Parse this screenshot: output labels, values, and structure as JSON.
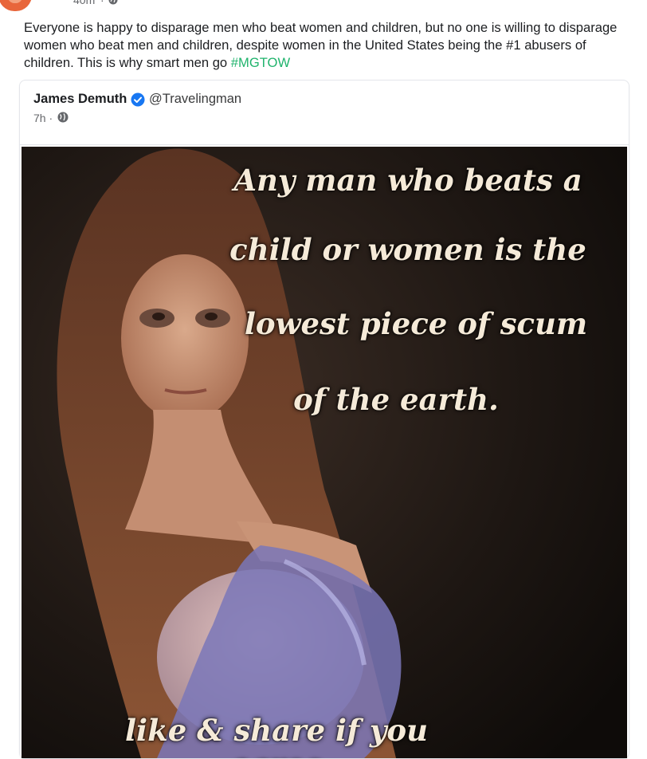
{
  "post": {
    "time": "40m",
    "separator": "·",
    "text": "Everyone is happy to disparage men who beat women and children, but no one is willing to disparage women who beat men and children, despite women in the United States being the #1 abusers of children. This is why smart men go ",
    "hashtag": "#MGTOW",
    "privacy_icon": "globe-icon"
  },
  "shared": {
    "author": "James Demuth",
    "verified_icon": "verified-badge-icon",
    "handle": "@Travelingman",
    "time": "7h ·",
    "privacy_icon": "globe-icon"
  },
  "image": {
    "line1": "Any man who beats a",
    "line2": "child or women is the",
    "line3": "lowest piece of scum",
    "line4": "of the earth.",
    "line5": "like & share if you agree"
  },
  "colors": {
    "hashtag": "#1fb36c",
    "verified": "#1877f2",
    "background": "#ffffff"
  }
}
